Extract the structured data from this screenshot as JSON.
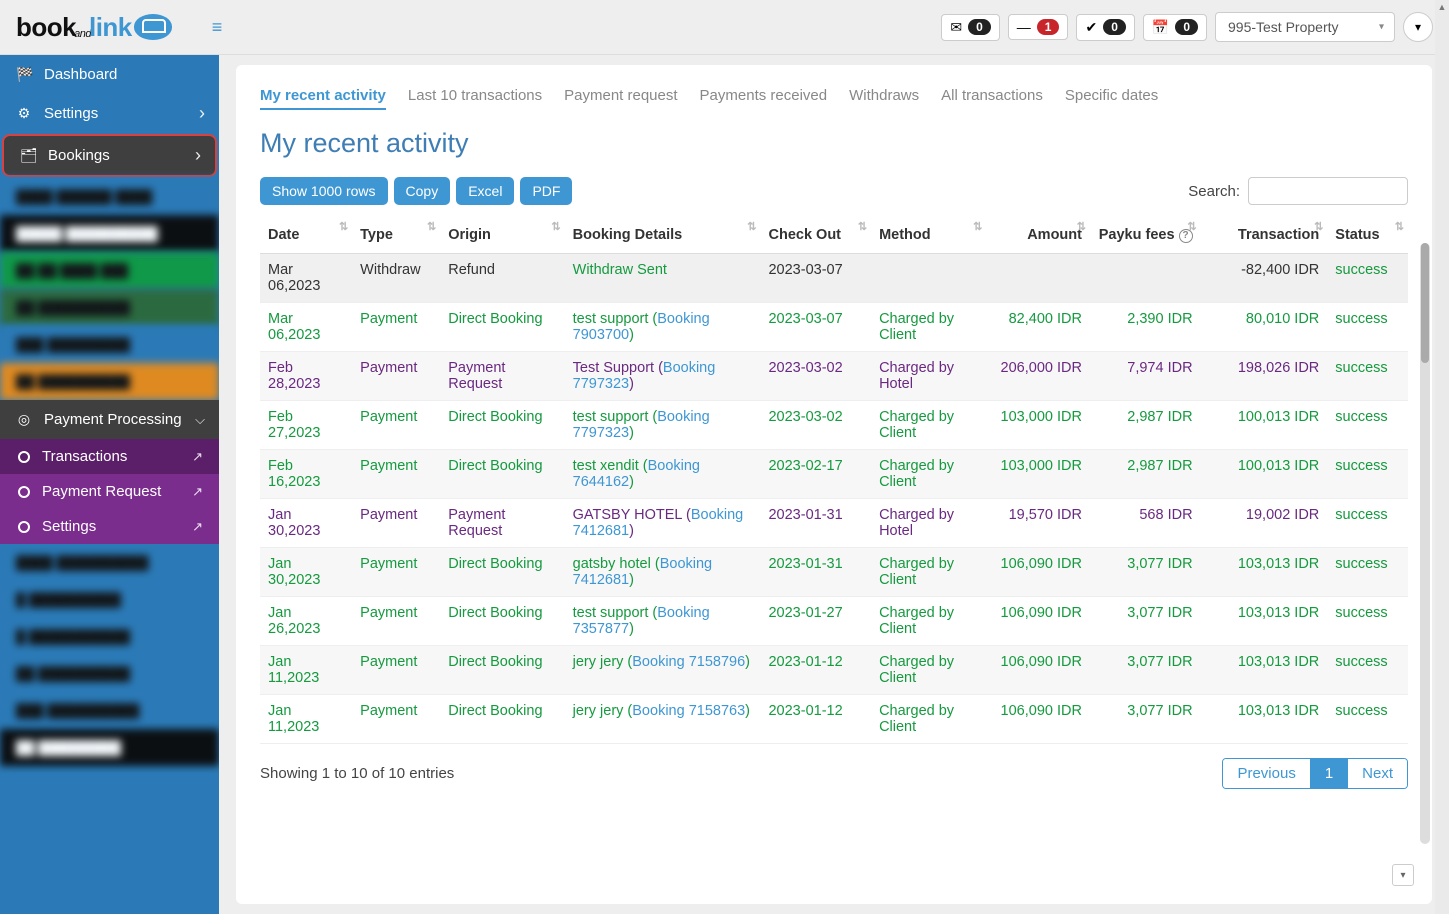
{
  "header": {
    "logo": {
      "p1": "book",
      "p2": "and",
      "p3": "link"
    },
    "badges": {
      "envelope": "0",
      "minus": "1",
      "check": "0",
      "calendar": "0"
    },
    "property": "995-Test Property"
  },
  "sidebar": {
    "dashboard": "Dashboard",
    "settings": "Settings",
    "bookings": "Bookings",
    "payment_processing": "Payment Processing",
    "sub": {
      "transactions": "Transactions",
      "payment_request": "Payment Request",
      "settings": "Settings"
    }
  },
  "tabs": {
    "recent": "My recent activity",
    "last10": "Last 10 transactions",
    "payreq": "Payment request",
    "payrec": "Payments received",
    "withdraws": "Withdraws",
    "alltrans": "All transactions",
    "dates": "Specific dates"
  },
  "page_title": "My recent activity",
  "buttons": {
    "show1000": "Show 1000 rows",
    "copy": "Copy",
    "excel": "Excel",
    "pdf": "PDF"
  },
  "search_label": "Search:",
  "columns": {
    "date": "Date",
    "type": "Type",
    "origin": "Origin",
    "details": "Booking Details",
    "checkout": "Check Out",
    "method": "Method",
    "amount": "Amount",
    "fees": "Payku fees",
    "transaction": "Transaction",
    "status": "Status"
  },
  "rows": [
    {
      "style": "dark",
      "date": "Mar 06,2023",
      "type": "Withdraw",
      "origin": "Refund",
      "details_text": "Withdraw Sent",
      "details_link": "",
      "booking_id": "",
      "checkout": "2023-03-07",
      "method": "",
      "amount": "",
      "fees": "",
      "transaction": "-82,400 IDR",
      "status": "success"
    },
    {
      "style": "green",
      "date": "Mar 06,2023",
      "type": "Payment",
      "origin": "Direct Booking",
      "details_text": "test support (",
      "details_link": "Booking 7903700",
      "booking_suffix": ")",
      "checkout": "2023-03-07",
      "method": "Charged by Client",
      "amount": "82,400 IDR",
      "fees": "2,390 IDR",
      "transaction": "80,010 IDR",
      "status": "success"
    },
    {
      "style": "purple",
      "date": "Feb 28,2023",
      "type": "Payment",
      "origin": "Payment Request",
      "details_text": "Test Support (",
      "details_link": "Booking 7797323",
      "booking_suffix": ")",
      "checkout": "2023-03-02",
      "method": "Charged by Hotel",
      "amount": "206,000 IDR",
      "fees": "7,974 IDR",
      "transaction": "198,026 IDR",
      "status": "success"
    },
    {
      "style": "green",
      "date": "Feb 27,2023",
      "type": "Payment",
      "origin": "Direct Booking",
      "details_text": "test support (",
      "details_link": "Booking 7797323",
      "booking_suffix": ")",
      "checkout": "2023-03-02",
      "method": "Charged by Client",
      "amount": "103,000 IDR",
      "fees": "2,987 IDR",
      "transaction": "100,013 IDR",
      "status": "success"
    },
    {
      "style": "green",
      "date": "Feb 16,2023",
      "type": "Payment",
      "origin": "Direct Booking",
      "details_text": "test xendit (",
      "details_link": "Booking 7644162",
      "booking_suffix": ")",
      "checkout": "2023-02-17",
      "method": "Charged by Client",
      "amount": "103,000 IDR",
      "fees": "2,987 IDR",
      "transaction": "100,013 IDR",
      "status": "success"
    },
    {
      "style": "purple",
      "date": "Jan 30,2023",
      "type": "Payment",
      "origin": "Payment Request",
      "details_text": "GATSBY HOTEL (",
      "details_link": "Booking 7412681",
      "booking_suffix": ")",
      "checkout": "2023-01-31",
      "method": "Charged by Hotel",
      "amount": "19,570 IDR",
      "fees": "568 IDR",
      "transaction": "19,002 IDR",
      "status": "success"
    },
    {
      "style": "green",
      "date": "Jan 30,2023",
      "type": "Payment",
      "origin": "Direct Booking",
      "details_text": "gatsby hotel (",
      "details_link": "Booking 7412681",
      "booking_suffix": ")",
      "checkout": "2023-01-31",
      "method": "Charged by Client",
      "amount": "106,090 IDR",
      "fees": "3,077 IDR",
      "transaction": "103,013 IDR",
      "status": "success"
    },
    {
      "style": "green",
      "date": "Jan 26,2023",
      "type": "Payment",
      "origin": "Direct Booking",
      "details_text": "test support (",
      "details_link": "Booking 7357877",
      "booking_suffix": ")",
      "checkout": "2023-01-27",
      "method": "Charged by Client",
      "amount": "106,090 IDR",
      "fees": "3,077 IDR",
      "transaction": "103,013 IDR",
      "status": "success"
    },
    {
      "style": "green",
      "date": "Jan 11,2023",
      "type": "Payment",
      "origin": "Direct Booking",
      "details_text": "jery jery (",
      "details_link": "Booking 7158796",
      "booking_suffix": ")",
      "checkout": "2023-01-12",
      "method": "Charged by Client",
      "amount": "106,090 IDR",
      "fees": "3,077 IDR",
      "transaction": "103,013 IDR",
      "status": "success"
    },
    {
      "style": "green",
      "date": "Jan 11,2023",
      "type": "Payment",
      "origin": "Direct Booking",
      "details_text": "jery jery (",
      "details_link": "Booking 7158763",
      "booking_suffix": ")",
      "checkout": "2023-01-12",
      "method": "Charged by Client",
      "amount": "106,090 IDR",
      "fees": "3,077 IDR",
      "transaction": "103,013 IDR",
      "status": "success"
    }
  ],
  "footer_info": "Showing 1 to 10 of 10 entries",
  "pager": {
    "prev": "Previous",
    "page": "1",
    "next": "Next"
  }
}
